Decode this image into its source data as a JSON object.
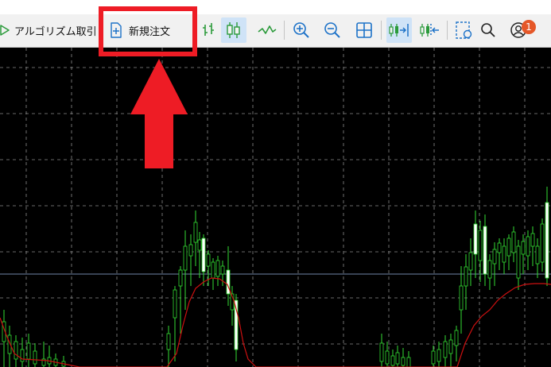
{
  "toolbar": {
    "algo_trading_label": "アルゴリズム取引",
    "new_order_label": "新規注文",
    "notification_count": "1"
  },
  "icons": {
    "algo_trading": "play-icon",
    "new_order": "new-order-icon",
    "bar_chart": "bar-chart-icon",
    "candlestick_chart": "candlestick-icon",
    "line_chart": "line-chart-icon",
    "zoom_in": "zoom-in-icon",
    "zoom_out": "zoom-out-icon",
    "tile_windows": "grid-icon",
    "auto_scroll": "auto-scroll-icon",
    "chart_shift": "chart-shift-icon",
    "screenshot": "screenshot-icon",
    "search": "search-icon",
    "account": "account-icon"
  },
  "colors": {
    "toolbar_bg": "#f1f1f1",
    "chart_bg": "#000000",
    "grid": "#8c8c8c",
    "bull_candle": "#33dd33",
    "bull_candle_body": "#ffffff",
    "moving_average": "#cc1010",
    "price_line": "#6f86a8",
    "highlight": "#ee1c25",
    "badge": "#e55728",
    "icon_blue": "#1d72c8",
    "icon_green": "#2a9a3a"
  }
}
